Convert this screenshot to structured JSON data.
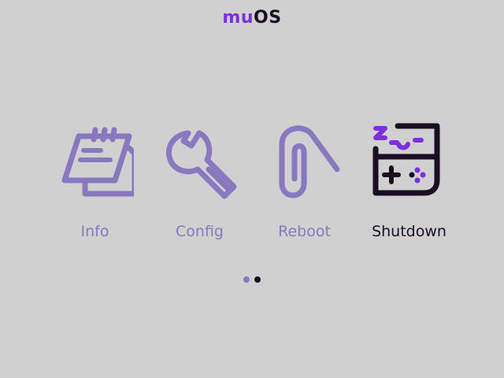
{
  "app": {
    "title_part1": "mu",
    "title_part2": "OS"
  },
  "colors": {
    "background": "#d0d0d0",
    "brand": "#7b2fe0",
    "idle": "#8878c0",
    "selected": "#1a0f22"
  },
  "menu": {
    "items": [
      {
        "label": "Info",
        "icon": "notepad-icon",
        "selected": false
      },
      {
        "label": "Config",
        "icon": "wrench-icon",
        "selected": false
      },
      {
        "label": "Reboot",
        "icon": "paperclip-icon",
        "selected": false
      },
      {
        "label": "Shutdown",
        "icon": "sleeping-handheld-icon",
        "selected": true
      }
    ]
  },
  "pager": {
    "total": 2,
    "current": 2
  }
}
